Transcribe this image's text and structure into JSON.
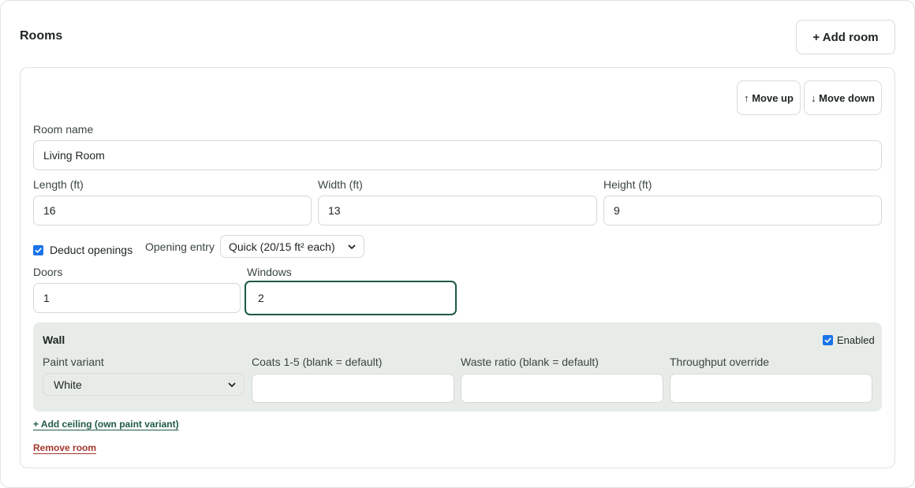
{
  "section": {
    "title": "Rooms",
    "add_room_label": "+ Add room"
  },
  "room": {
    "move_up_label": "↑ Move up",
    "move_down_label": "↓ Move down",
    "name_label": "Room name",
    "name_value": "Living Room",
    "length_label": "Length (ft)",
    "length_value": "16",
    "width_label": "Width (ft)",
    "width_value": "13",
    "height_label": "Height (ft)",
    "height_value": "9",
    "deduct_openings_label": "Deduct openings",
    "deduct_openings_checked": true,
    "opening_entry_label": "Opening entry",
    "opening_entry_value": "Quick (20/15 ft² each)",
    "doors_label": "Doors",
    "doors_value": "1",
    "windows_label": "Windows",
    "windows_value": "2",
    "wall": {
      "title": "Wall",
      "enabled_label": "Enabled",
      "enabled_checked": true,
      "paint_variant_label": "Paint variant",
      "paint_variant_value": "White",
      "coats_label": "Coats 1-5 (blank = default)",
      "coats_value": "",
      "waste_label": "Waste ratio (blank = default)",
      "waste_value": "",
      "throughput_label": "Throughput override",
      "throughput_value": ""
    },
    "add_ceiling_label": "+ Add ceiling (own paint variant)",
    "remove_room_label": "Remove room"
  },
  "colors": {
    "accent_green": "#1f5a43",
    "danger_red": "#a3362c",
    "checkbox_blue": "#1a73e8",
    "panel_bg": "#e8ece8"
  }
}
